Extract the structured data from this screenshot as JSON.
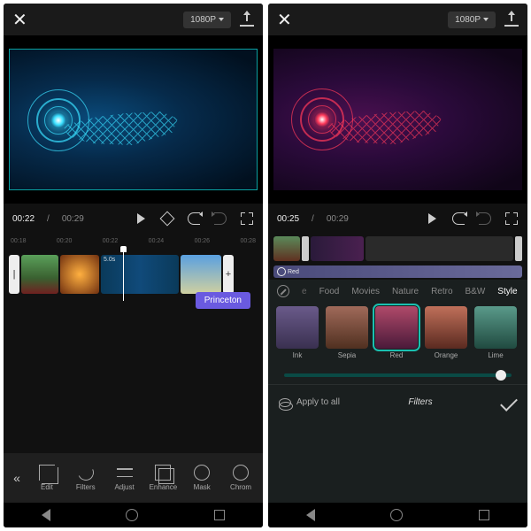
{
  "left": {
    "top": {
      "resolution": "1080P"
    },
    "play": {
      "current": "00:22",
      "total": "00:29"
    },
    "ruler": [
      "00:18",
      "00:20",
      "00:22",
      "00:24",
      "00:26",
      "00:28"
    ],
    "clip_duration": "5.0s",
    "effect_tag": "Princeton",
    "tools": [
      {
        "id": "edit",
        "label": "Edit"
      },
      {
        "id": "filters",
        "label": "Filters"
      },
      {
        "id": "adjust",
        "label": "Adjust"
      },
      {
        "id": "enhance",
        "label": "Enhance"
      },
      {
        "id": "mask",
        "label": "Mask"
      },
      {
        "id": "chroma",
        "label": "Chrom"
      }
    ]
  },
  "right": {
    "top": {
      "resolution": "1080P"
    },
    "play": {
      "current": "00:25",
      "total": "00:29"
    },
    "audio_label": "Red",
    "filters": {
      "categories": [
        {
          "id": "fav",
          "label": "e",
          "dim": true
        },
        {
          "id": "food",
          "label": "Food"
        },
        {
          "id": "movies",
          "label": "Movies"
        },
        {
          "id": "nature",
          "label": "Nature"
        },
        {
          "id": "retro",
          "label": "Retro"
        },
        {
          "id": "bw",
          "label": "B&W"
        },
        {
          "id": "style",
          "label": "Style",
          "active": true
        }
      ],
      "swatches": [
        {
          "id": "ink",
          "label": "Ink",
          "cls": "th-ink"
        },
        {
          "id": "sepia",
          "label": "Sepia",
          "cls": "th-sepia"
        },
        {
          "id": "red",
          "label": "Red",
          "cls": "th-red",
          "selected": true
        },
        {
          "id": "orange",
          "label": "Orange",
          "cls": "th-orange"
        },
        {
          "id": "lime",
          "label": "Lime",
          "cls": "th-lime"
        }
      ],
      "apply_all": "Apply to all",
      "panel_title": "Filters"
    }
  }
}
